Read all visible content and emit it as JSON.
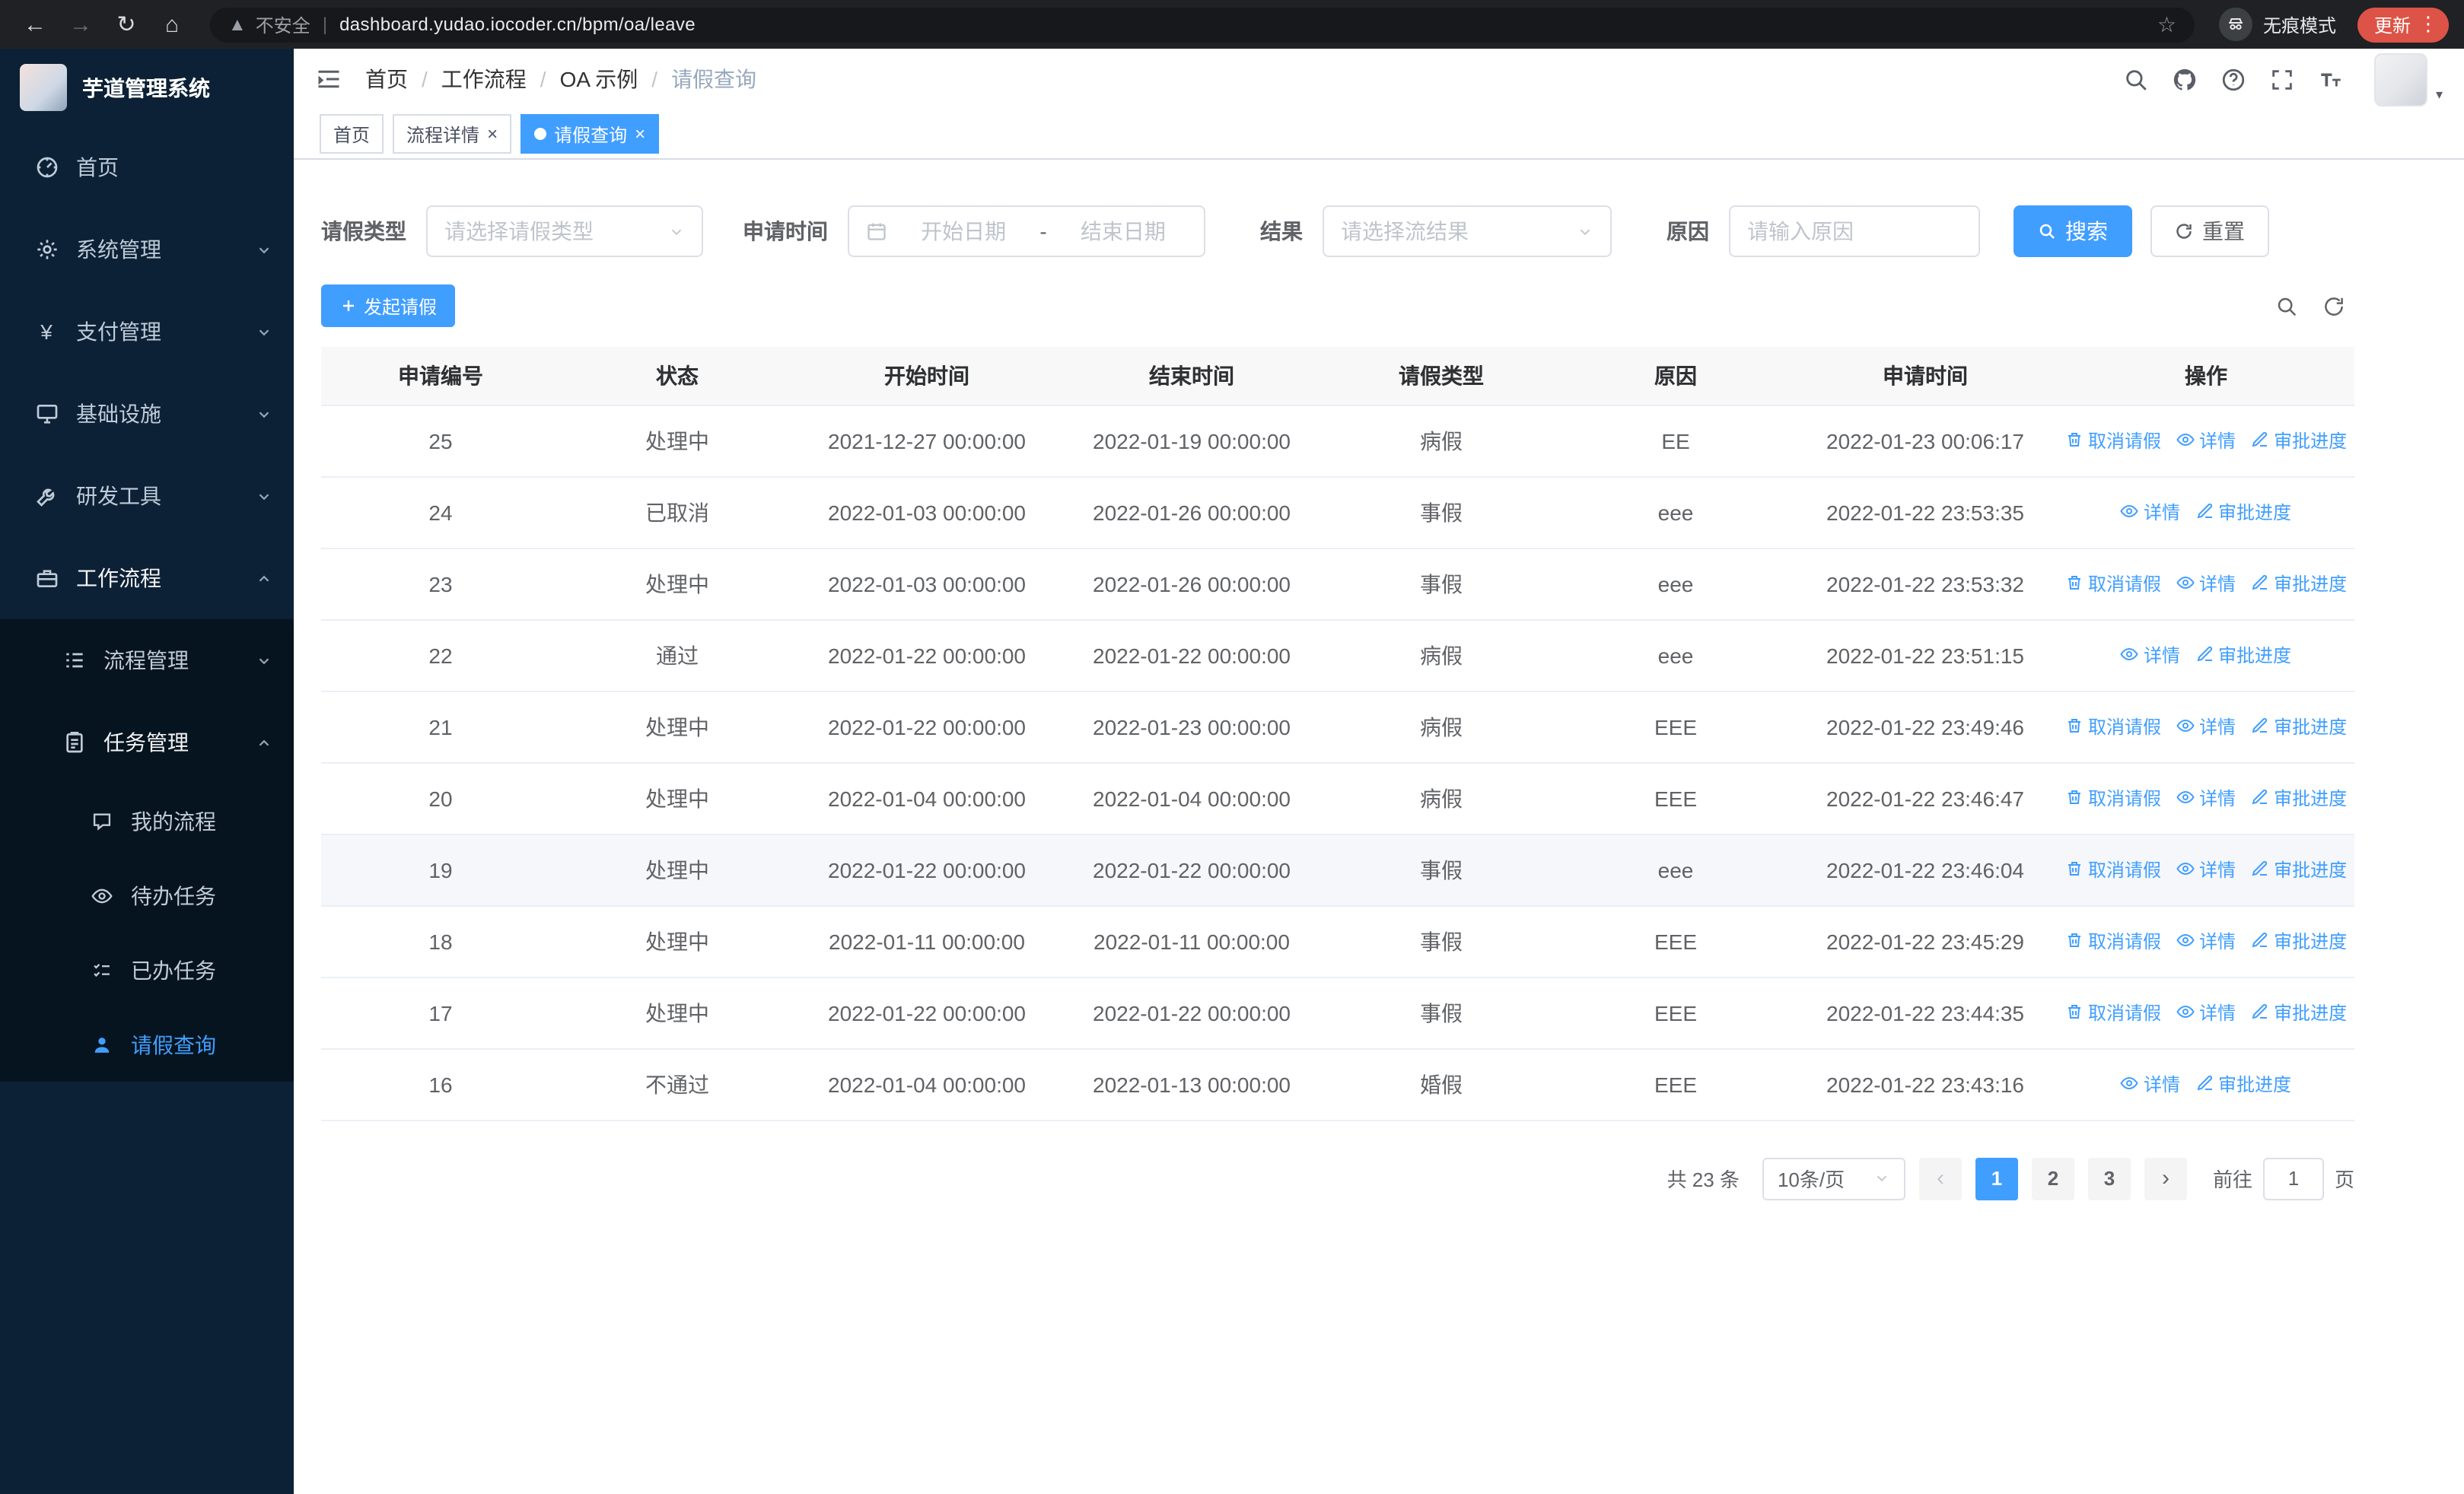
{
  "browser": {
    "security_label": "不安全",
    "url": "dashboard.yudao.iocoder.cn/bpm/oa/leave",
    "incognito_label": "无痕模式",
    "update_label": "更新"
  },
  "sidebar": {
    "title": "芋道管理系统",
    "items": [
      {
        "label": "首页",
        "icon": "dashboard-icon"
      },
      {
        "label": "系统管理",
        "icon": "gear-icon",
        "chevron": "down"
      },
      {
        "label": "支付管理",
        "icon": "yen-icon",
        "chevron": "down"
      },
      {
        "label": "基础设施",
        "icon": "monitor-icon",
        "chevron": "down"
      },
      {
        "label": "研发工具",
        "icon": "tool-icon",
        "chevron": "down"
      },
      {
        "label": "工作流程",
        "icon": "briefcase-icon",
        "chevron": "up"
      },
      {
        "label": "流程管理",
        "icon": "list-tree-icon",
        "chevron": "down"
      },
      {
        "label": "任务管理",
        "icon": "clipboard-icon",
        "chevron": "up"
      },
      {
        "label": "我的流程",
        "icon": "chat-icon"
      },
      {
        "label": "待办任务",
        "icon": "eye-icon"
      },
      {
        "label": "已办任务",
        "icon": "done-icon"
      },
      {
        "label": "请假查询",
        "icon": "user-icon",
        "active": true
      }
    ]
  },
  "navbar": {
    "breadcrumb": [
      "首页",
      "工作流程",
      "OA 示例",
      "请假查询"
    ]
  },
  "tabs": [
    {
      "label": "首页"
    },
    {
      "label": "流程详情"
    },
    {
      "label": "请假查询"
    }
  ],
  "filters": {
    "leave_type_label": "请假类型",
    "leave_type_placeholder": "请选择请假类型",
    "apply_time_label": "申请时间",
    "start_date_placeholder": "开始日期",
    "date_separator": "-",
    "end_date_placeholder": "结束日期",
    "result_label": "结果",
    "result_placeholder": "请选择流结果",
    "reason_label": "原因",
    "reason_placeholder": "请输入原因",
    "search_label": "搜索",
    "reset_label": "重置"
  },
  "toolbar": {
    "create_label": "发起请假"
  },
  "table": {
    "columns": [
      "申请编号",
      "状态",
      "开始时间",
      "结束时间",
      "请假类型",
      "原因",
      "申请时间",
      "操作"
    ],
    "column_keys": [
      "id",
      "status",
      "start",
      "end",
      "type",
      "reason",
      "applied"
    ],
    "action_labels": {
      "cancel": "取消请假",
      "detail": "详情",
      "progress": "审批进度"
    },
    "rows": [
      {
        "id": "25",
        "status": "处理中",
        "start": "2021-12-27 00:00:00",
        "end": "2022-01-19 00:00:00",
        "type": "病假",
        "reason": "EE",
        "applied": "2022-01-23 00:06:17",
        "actions": [
          "cancel",
          "detail",
          "progress"
        ]
      },
      {
        "id": "24",
        "status": "已取消",
        "start": "2022-01-03 00:00:00",
        "end": "2022-01-26 00:00:00",
        "type": "事假",
        "reason": "eee",
        "applied": "2022-01-22 23:53:35",
        "actions": [
          "detail",
          "progress"
        ]
      },
      {
        "id": "23",
        "status": "处理中",
        "start": "2022-01-03 00:00:00",
        "end": "2022-01-26 00:00:00",
        "type": "事假",
        "reason": "eee",
        "applied": "2022-01-22 23:53:32",
        "actions": [
          "cancel",
          "detail",
          "progress"
        ]
      },
      {
        "id": "22",
        "status": "通过",
        "start": "2022-01-22 00:00:00",
        "end": "2022-01-22 00:00:00",
        "type": "病假",
        "reason": "eee",
        "applied": "2022-01-22 23:51:15",
        "actions": [
          "detail",
          "progress"
        ]
      },
      {
        "id": "21",
        "status": "处理中",
        "start": "2022-01-22 00:00:00",
        "end": "2022-01-23 00:00:00",
        "type": "病假",
        "reason": "EEE",
        "applied": "2022-01-22 23:49:46",
        "actions": [
          "cancel",
          "detail",
          "progress"
        ]
      },
      {
        "id": "20",
        "status": "处理中",
        "start": "2022-01-04 00:00:00",
        "end": "2022-01-04 00:00:00",
        "type": "病假",
        "reason": "EEE",
        "applied": "2022-01-22 23:46:47",
        "actions": [
          "cancel",
          "detail",
          "progress"
        ]
      },
      {
        "id": "19",
        "status": "处理中",
        "start": "2022-01-22 00:00:00",
        "end": "2022-01-22 00:00:00",
        "type": "事假",
        "reason": "eee",
        "applied": "2022-01-22 23:46:04",
        "actions": [
          "cancel",
          "detail",
          "progress"
        ],
        "highlighted": true
      },
      {
        "id": "18",
        "status": "处理中",
        "start": "2022-01-11 00:00:00",
        "end": "2022-01-11 00:00:00",
        "type": "事假",
        "reason": "EEE",
        "applied": "2022-01-22 23:45:29",
        "actions": [
          "cancel",
          "detail",
          "progress"
        ]
      },
      {
        "id": "17",
        "status": "处理中",
        "start": "2022-01-22 00:00:00",
        "end": "2022-01-22 00:00:00",
        "type": "事假",
        "reason": "EEE",
        "applied": "2022-01-22 23:44:35",
        "actions": [
          "cancel",
          "detail",
          "progress"
        ]
      },
      {
        "id": "16",
        "status": "不通过",
        "start": "2022-01-04 00:00:00",
        "end": "2022-01-13 00:00:00",
        "type": "婚假",
        "reason": "EEE",
        "applied": "2022-01-22 23:43:16",
        "actions": [
          "detail",
          "progress"
        ]
      }
    ]
  },
  "pagination": {
    "total_label": "共 23 条",
    "page_size_label": "10条/页",
    "pages": [
      "1",
      "2",
      "3"
    ],
    "active_page": "1",
    "goto_label": "前往",
    "goto_value": "1",
    "unit_label": "页"
  },
  "colors": {
    "primary": "#409eff",
    "sidebar_bg": "#0c2135",
    "sidebar_submenu_bg": "#06141f",
    "update_chip": "#de5347"
  }
}
